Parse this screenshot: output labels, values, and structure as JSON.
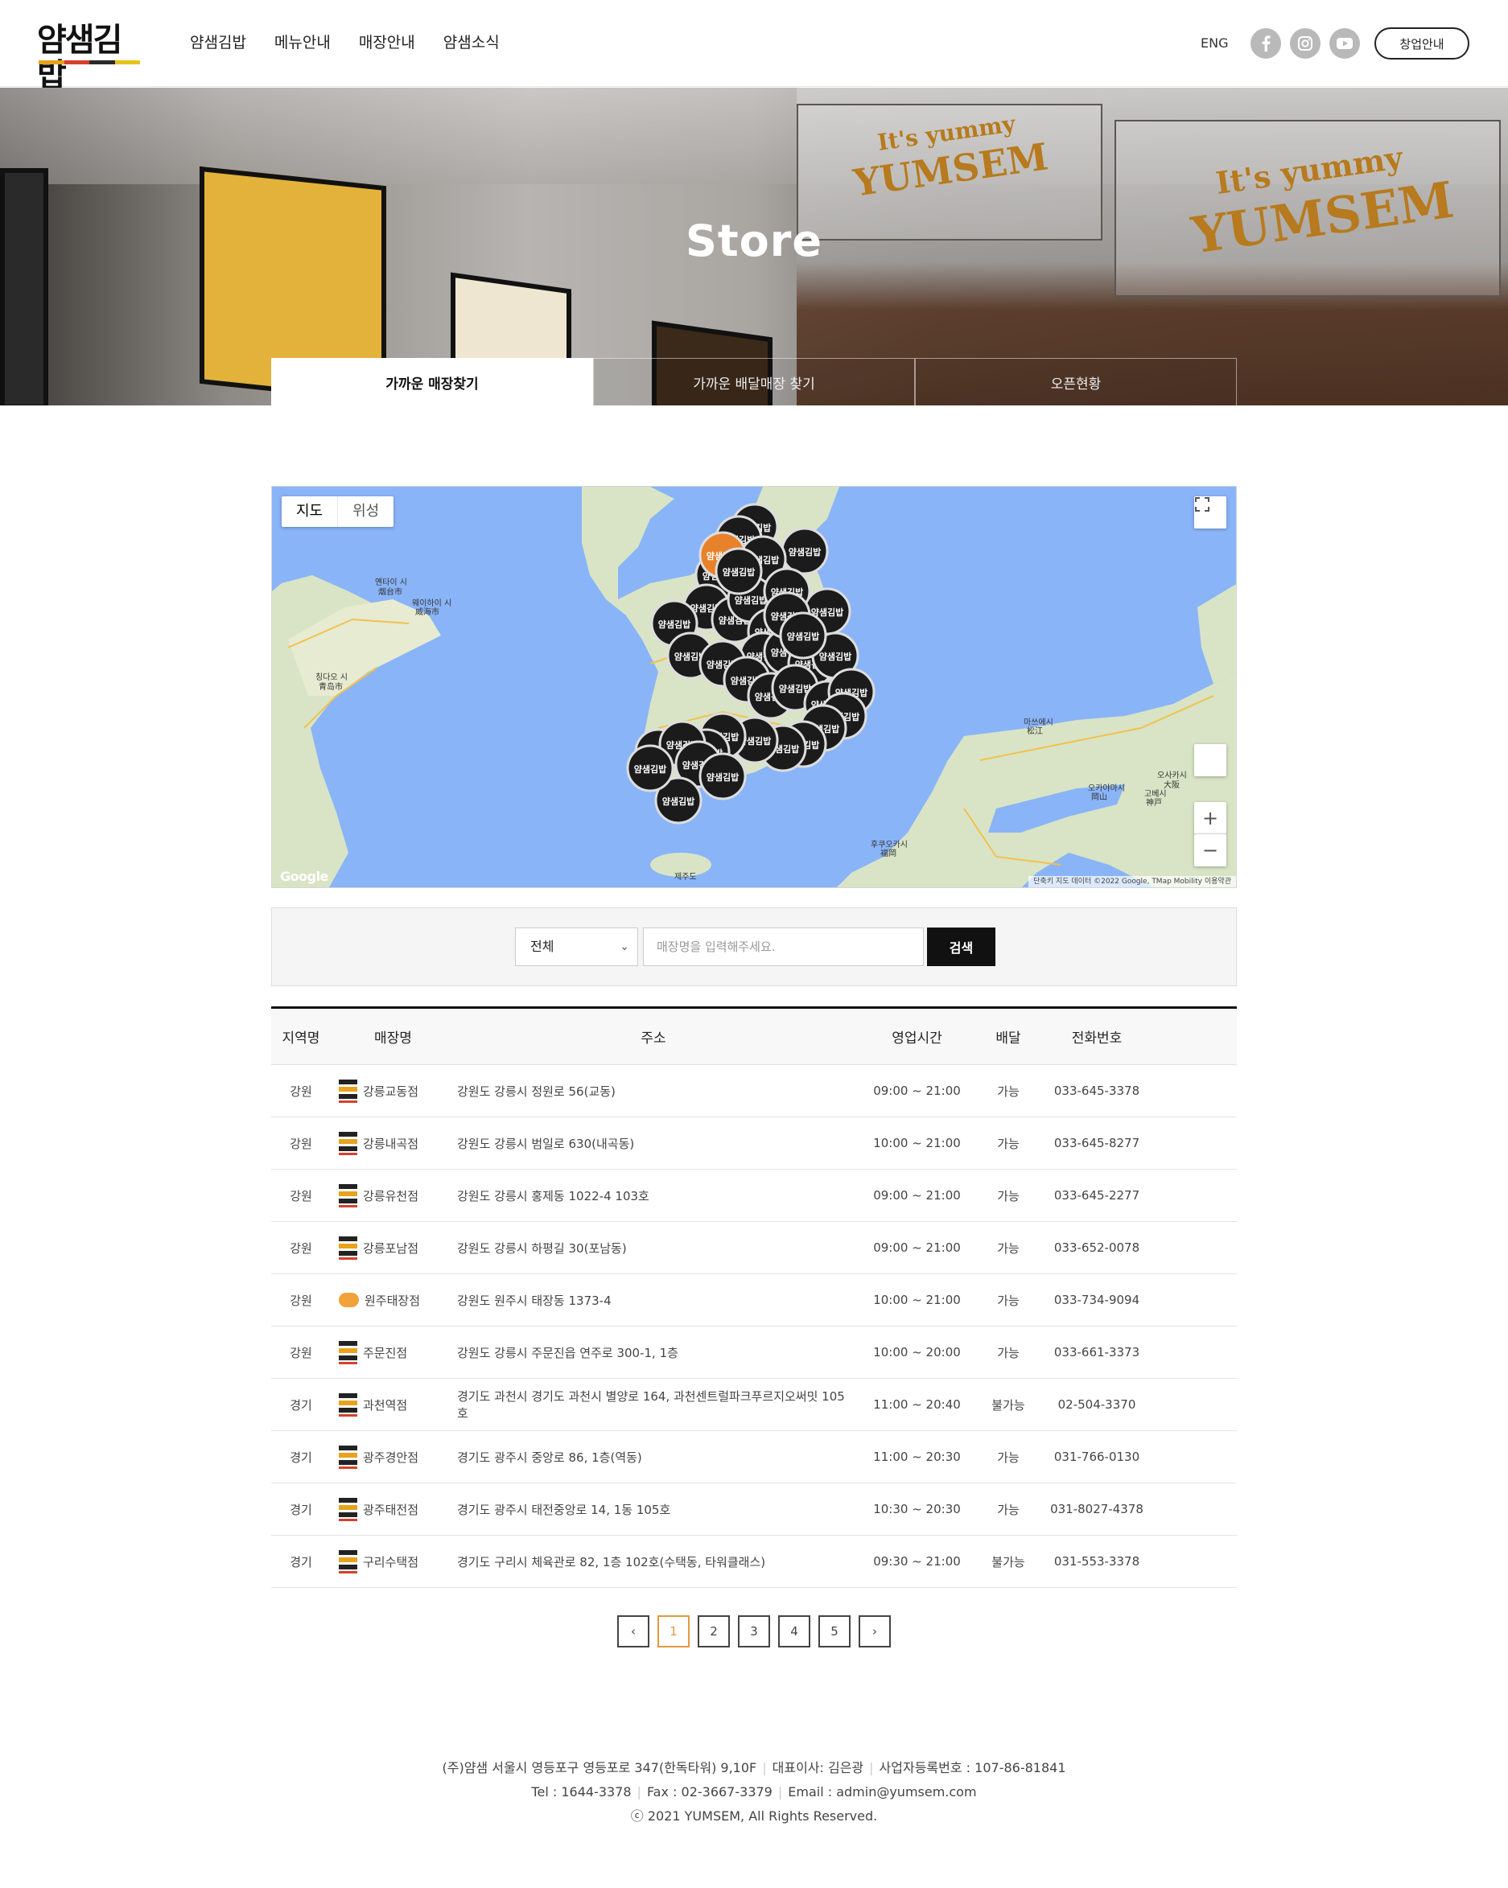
{
  "header": {
    "logo": "얌샘김밥",
    "logo_colors": [
      "#e8a21c",
      "#d6402a",
      "#2a2a2a",
      "#e8c21c"
    ],
    "nav": [
      "얌샘김밥",
      "메뉴안내",
      "매장안내",
      "얌샘소식"
    ],
    "lang": "ENG",
    "social_icons": [
      "facebook-icon",
      "instagram-icon",
      "youtube-icon"
    ],
    "franchise_button": "창업안내"
  },
  "hero": {
    "title": "Store",
    "signs": [
      "It's yummy",
      "YUMSEM"
    ],
    "tabs": [
      "가까운 매장찾기",
      "가까운 배달매장 찾기",
      "오픈현황"
    ],
    "active_tab": 0
  },
  "map": {
    "type_buttons": [
      "지도",
      "위성"
    ],
    "active_type": "지도",
    "labels": {
      "yantai": "옌타이 시",
      "yantai_cn": "烟台市",
      "weihai": "웨이하이 시",
      "weihai_cn": "威海市",
      "qingdao": "칭다오 시",
      "qingdao_cn": "青岛市",
      "fukuoka": "후쿠오카시",
      "fukuoka_cn": "福岡",
      "osaka": "오사카시",
      "osaka_cn": "大阪",
      "okayama": "오카야마시",
      "okayama_cn": "岡山",
      "kobe": "고베시",
      "kobe_cn": "神戸",
      "matsue": "마쓰에시",
      "matsue_cn": "松江",
      "jeju": "제주도"
    },
    "zoom_in": "+",
    "zoom_out": "−",
    "google": "Google",
    "attribution": "단축키  지도 데이터 ©2022 Google, TMap Mobility  이용약관",
    "marker_label": "얌샘김밥"
  },
  "search": {
    "select_value": "전체",
    "placeholder": "매장명을 입력해주세요.",
    "button": "검색"
  },
  "table": {
    "headers": [
      "지역명",
      "매장명",
      "주소",
      "영업시간",
      "배달",
      "전화번호"
    ],
    "rows": [
      {
        "region": "강원",
        "icon": "yumsem-logo-icon",
        "name": "강릉교동점",
        "address": "강원도 강릉시 정원로 56(교동)",
        "hours": "09:00 ~ 21:00",
        "delivery": "가능",
        "tel": "033-645-3378"
      },
      {
        "region": "강원",
        "icon": "yumsem-logo-icon",
        "name": "강릉내곡점",
        "address": "강원도 강릉시 범일로 630(내곡동)",
        "hours": "10:00 ~ 21:00",
        "delivery": "가능",
        "tel": "033-645-8277"
      },
      {
        "region": "강원",
        "icon": "yumsem-logo-icon",
        "name": "강릉유천점",
        "address": "강원도 강릉시 홍제동 1022-4 103호",
        "hours": "09:00 ~ 21:00",
        "delivery": "가능",
        "tel": "033-645-2277"
      },
      {
        "region": "강원",
        "icon": "yumsem-logo-icon",
        "name": "강릉포남점",
        "address": "강원도 강릉시 하평길 30(포남동)",
        "hours": "09:00 ~ 21:00",
        "delivery": "가능",
        "tel": "033-652-0078"
      },
      {
        "region": "강원",
        "icon": "orange-badge-icon",
        "name": "원주태장점",
        "address": "강원도 원주시 태장동 1373-4",
        "hours": "10:00 ~ 21:00",
        "delivery": "가능",
        "tel": "033-734-9094"
      },
      {
        "region": "강원",
        "icon": "yumsem-logo-icon",
        "name": "주문진점",
        "address": "강원도 강릉시 주문진읍 연주로 300-1, 1층",
        "hours": "10:00 ~ 20:00",
        "delivery": "가능",
        "tel": "033-661-3373"
      },
      {
        "region": "경기",
        "icon": "yumsem-logo-icon",
        "name": "과천역점",
        "address": "경기도 과천시 경기도 과천시 별양로 164, 과천센트럴파크푸르지오써밋 105호",
        "hours": "11:00 ~ 20:40",
        "delivery": "불가능",
        "tel": "02-504-3370"
      },
      {
        "region": "경기",
        "icon": "yumsem-logo-icon",
        "name": "광주경안점",
        "address": "경기도 광주시 중앙로 86, 1층(역동)",
        "hours": "11:00 ~ 20:30",
        "delivery": "가능",
        "tel": "031-766-0130"
      },
      {
        "region": "경기",
        "icon": "yumsem-logo-icon",
        "name": "광주태전점",
        "address": "경기도 광주시 태전중앙로 14, 1동 105호",
        "hours": "10:30 ~ 20:30",
        "delivery": "가능",
        "tel": "031-8027-4378"
      },
      {
        "region": "경기",
        "icon": "yumsem-logo-icon",
        "name": "구리수택점",
        "address": "경기도 구리시 체육관로 82, 1층 102호(수택동, 타워클래스)",
        "hours": "09:30 ~ 21:00",
        "delivery": "불가능",
        "tel": "031-553-3378"
      }
    ]
  },
  "pagination": {
    "prev": "‹",
    "pages": [
      "1",
      "2",
      "3",
      "4",
      "5"
    ],
    "current": "1",
    "next": "›"
  },
  "footer": {
    "company": "(주)얌샘 서울시 영등포구 영등포로 347(한독타워) 9,10F",
    "ceo": "대표이사: 김은광",
    "bizno": "사업자등록번호 : 107-86-81841",
    "tel": "Tel : 1644-3378",
    "fax": "Fax : 02-3667-3379",
    "email": "Email : admin@yumsem.com",
    "copyright": "ⓒ 2021 YUMSEM, All Rights Reserved."
  }
}
